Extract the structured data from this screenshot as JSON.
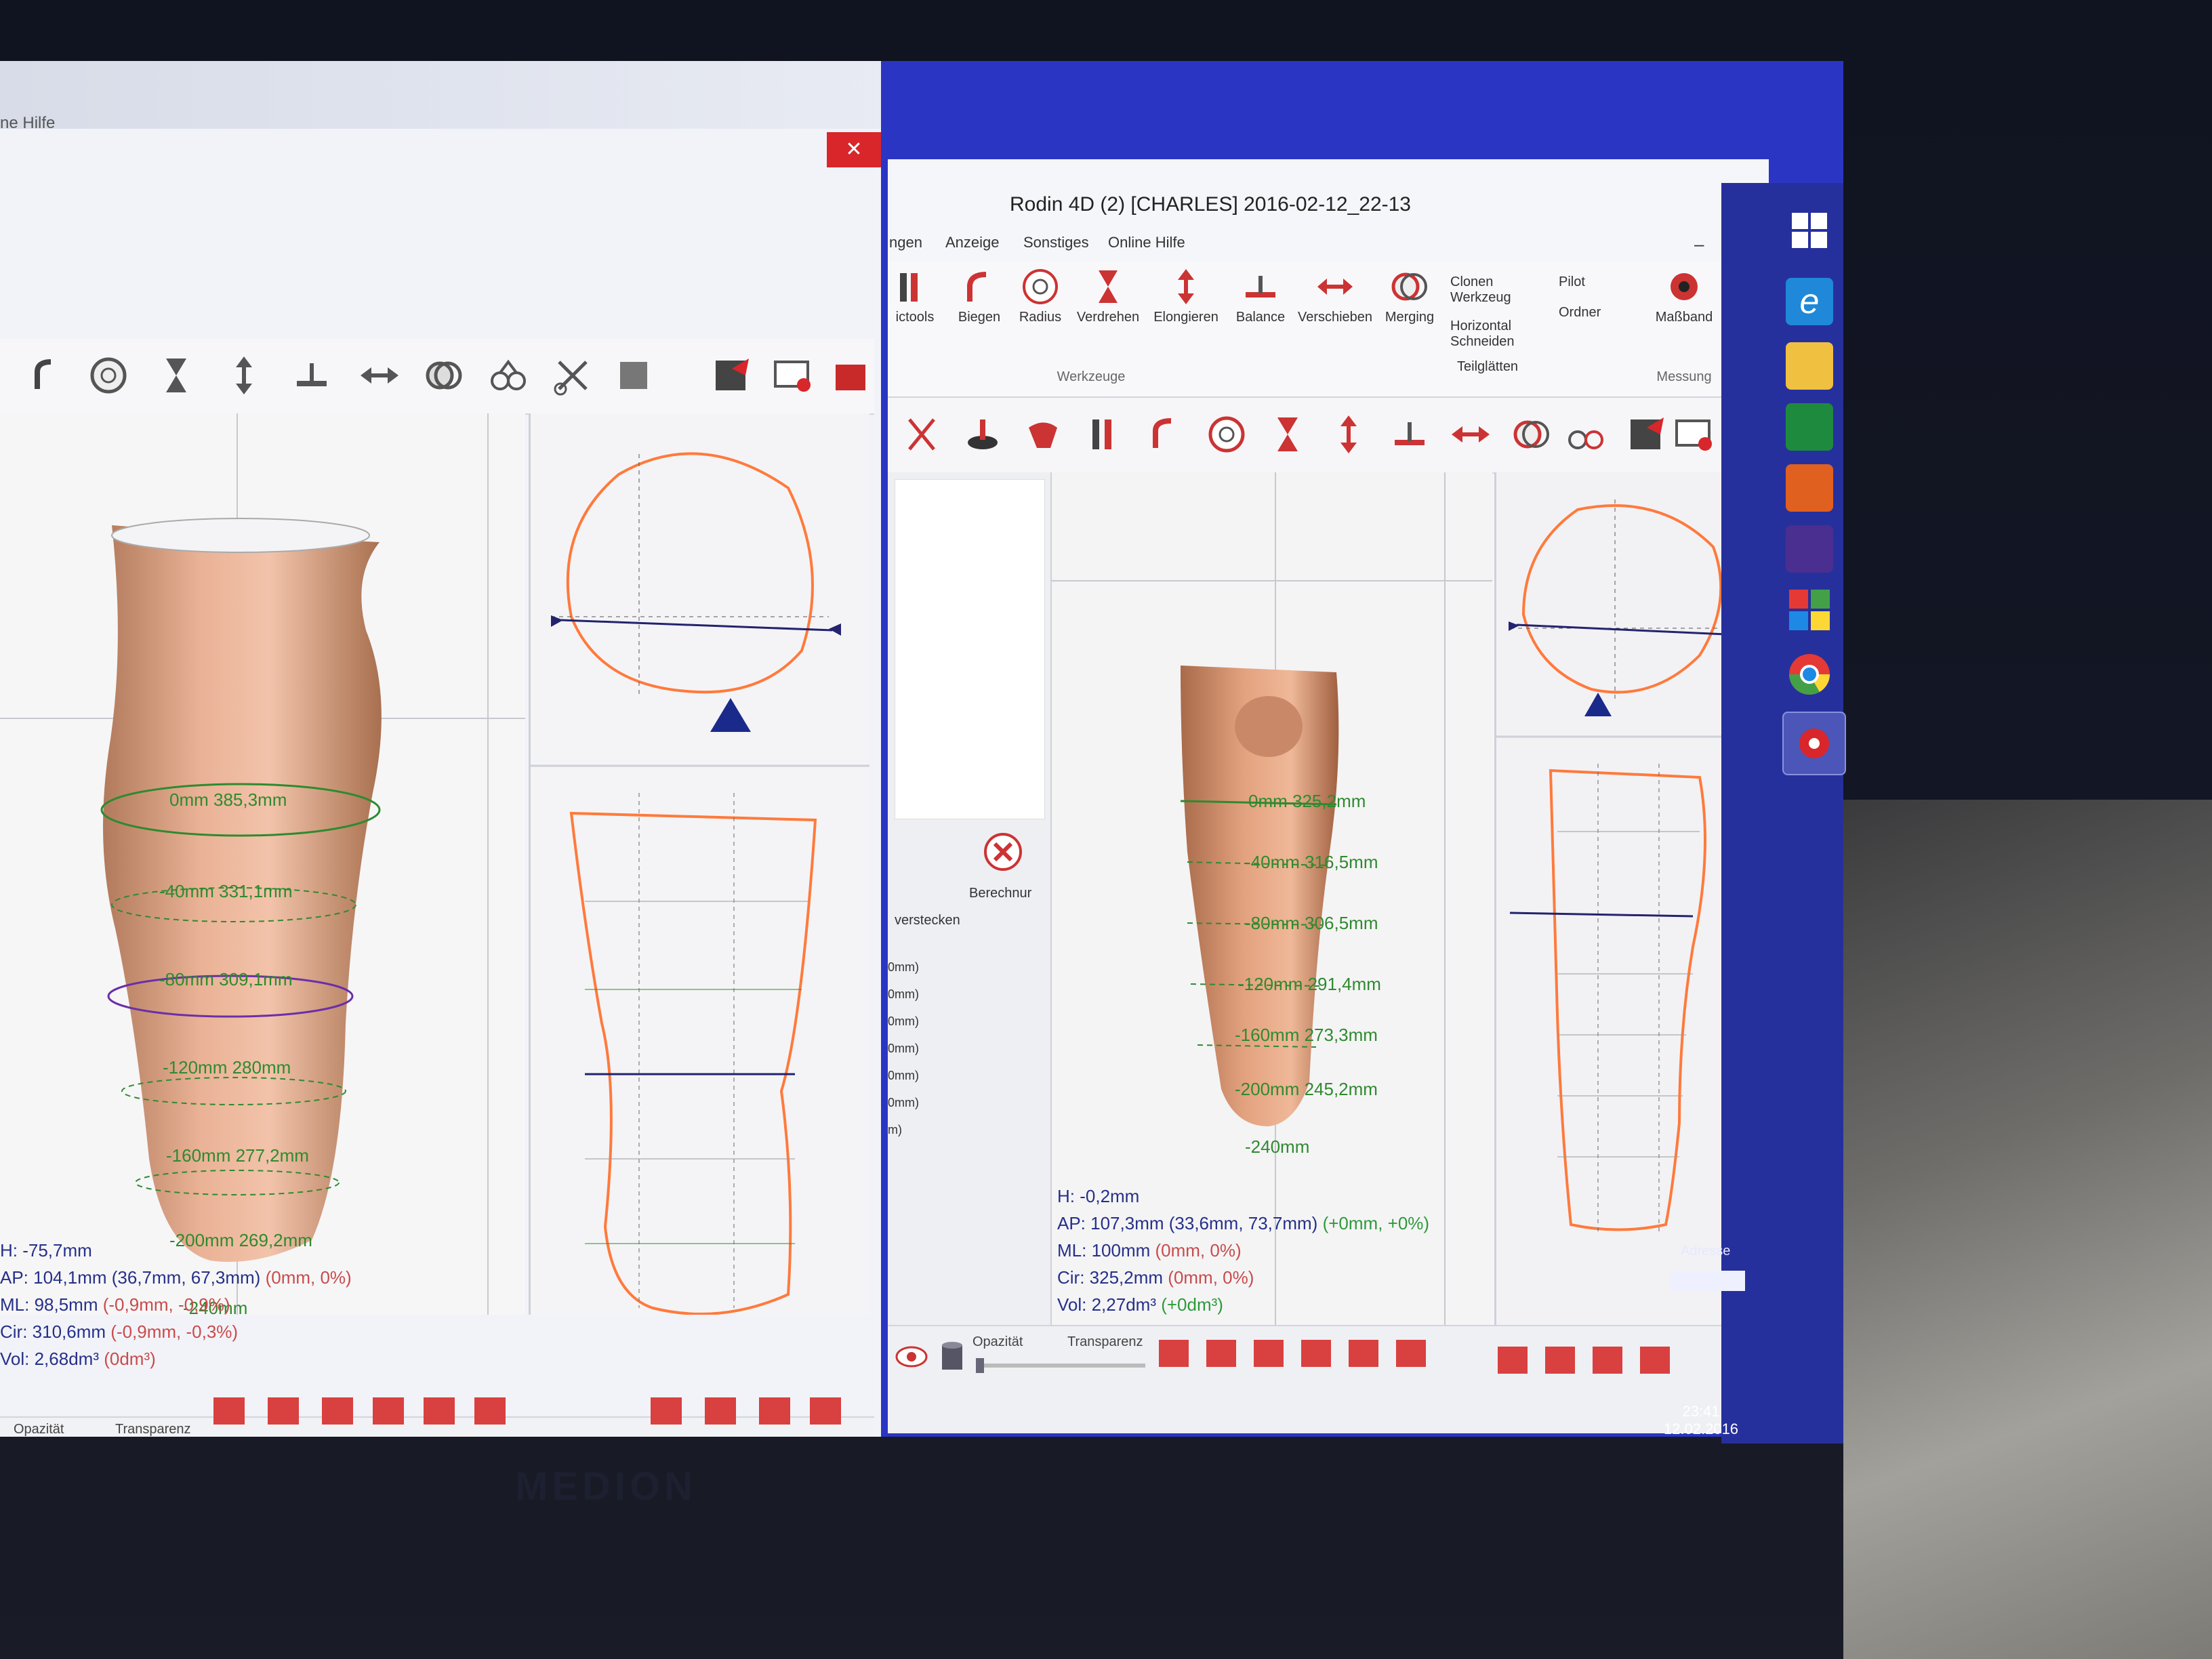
{
  "device": {
    "brand": "MEDION"
  },
  "left_window": {
    "menu_help": "ne Hilfe",
    "close_symbol": "✕",
    "measurements": [
      {
        "label": "0mm 385,3mm"
      },
      {
        "label": "-40mm 331,1mm"
      },
      {
        "label": "-80mm 309,1mm"
      },
      {
        "label": "-120mm 280mm"
      },
      {
        "label": "-160mm 277,2mm"
      },
      {
        "label": "-200mm 269,2mm"
      },
      {
        "label": "-240mm"
      }
    ],
    "info": {
      "h": "H: -75,7mm",
      "ap": "AP: 104,1mm (36,7mm, 67,3mm)",
      "ap_delta": "(0mm, 0%)",
      "ml": "ML: 98,5mm",
      "ml_delta": "(-0,9mm, -0,9%)",
      "cir": "Cir: 310,6mm",
      "cir_delta": "(-0,9mm, -0,3%)",
      "vol": "Vol: 2,68dm³",
      "vol_delta": "(0dm³)"
    },
    "bottom": {
      "opacity_label": "Opazität",
      "transparency_label": "Transparenz"
    }
  },
  "right_window": {
    "title": "Rodin 4D (2) [CHARLES] 2016-02-12_22-13",
    "menu_tabs": [
      "ngen",
      "Anzeige",
      "Sonstiges",
      "Online Hilfe"
    ],
    "ribbon": {
      "tools": [
        "ictools",
        "Biegen",
        "Radius",
        "Verdrehen",
        "Elongieren",
        "Balance",
        "Verschieben",
        "Merging"
      ],
      "clone_lines": [
        "Clonen",
        "Werkzeug"
      ],
      "horizontal_lines": [
        "Horizontal",
        "Schneiden"
      ],
      "teilglaetten": "Teilglätten",
      "pilot": "Pilot",
      "ordner": "Ordner",
      "massband": "Maßband",
      "group_werkzeuge": "Werkzeuge",
      "group_messung": "Messung"
    },
    "side_panel": {
      "berechnen": "Berechnur",
      "verstecken": "verstecken",
      "values": [
        "0mm)",
        "0mm)",
        "0mm)",
        "0mm)",
        "0mm)",
        "0mm)",
        "m)"
      ]
    },
    "measurements": [
      {
        "label": "0mm 325,2mm"
      },
      {
        "label": "-40mm 316,5mm"
      },
      {
        "label": "-80mm 306,5mm"
      },
      {
        "label": "-120mm 291,4mm"
      },
      {
        "label": "-160mm 273,3mm"
      },
      {
        "label": "-200mm 245,2mm"
      },
      {
        "label": "-240mm"
      }
    ],
    "info": {
      "h": "H: -0,2mm",
      "ap": "AP: 107,3mm (33,6mm, 73,7mm)",
      "ap_delta": "(+0mm, +0%)",
      "ml": "ML: 100mm",
      "ml_delta": "(0mm, 0%)",
      "cir": "Cir: 325,2mm",
      "cir_delta": "(0mm, 0%)",
      "vol": "Vol: 2,27dm³",
      "vol_delta": "(+0dm³)"
    },
    "bottom": {
      "opacity_label": "Opazität",
      "transparency_label": "Transparenz"
    }
  },
  "taskbar": {
    "adresse": "Adresse",
    "time": "23:41",
    "date": "12.02.2016",
    "icons": [
      "windows-start-icon",
      "internet-explorer-icon",
      "file-explorer-icon",
      "store-icon",
      "media-player-icon",
      "paint-icon",
      "windows-flag-icon",
      "chrome-icon",
      "rodin-app-icon"
    ]
  },
  "colors": {
    "accent_blue": "#2a35c4",
    "close_red": "#d8262b",
    "measure_green": "#2f8a2f",
    "outline_orange": "#ff7a3c",
    "info_text_blue": "#263089",
    "delta_red": "#c94b4b"
  }
}
